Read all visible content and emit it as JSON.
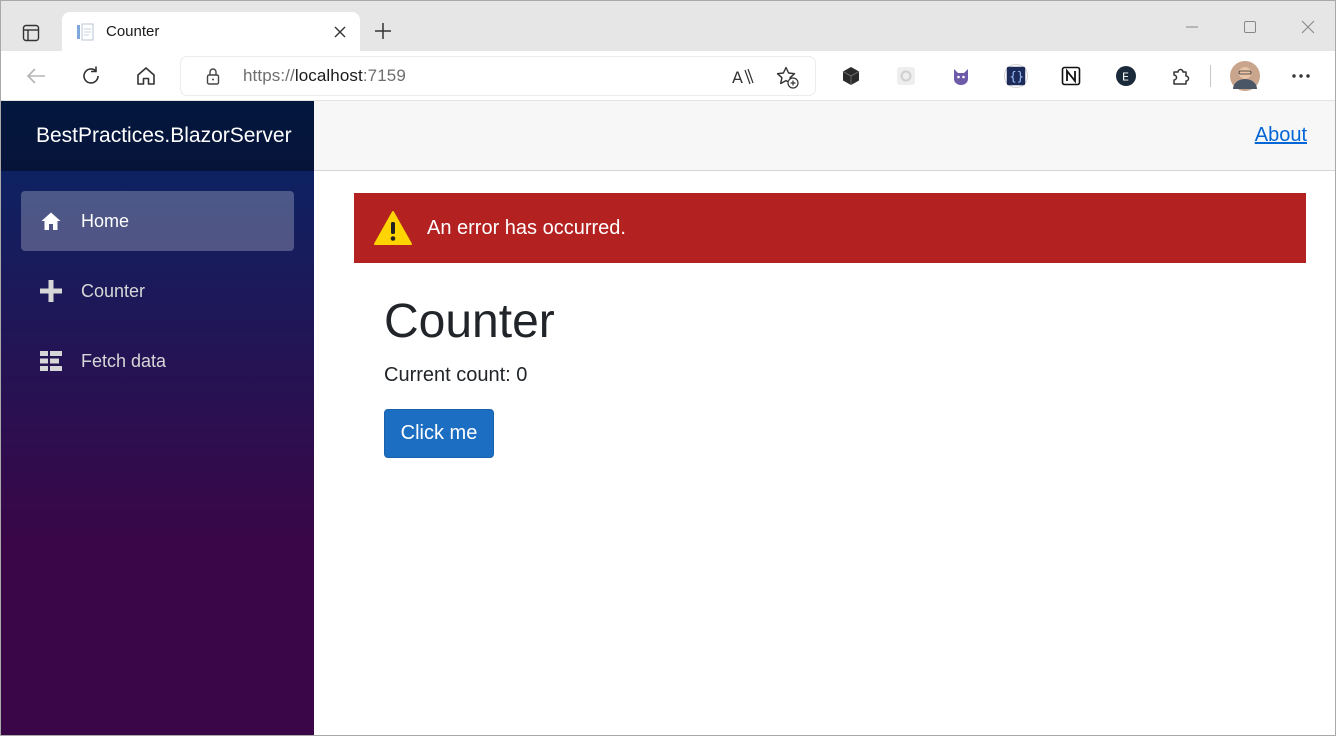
{
  "browser": {
    "tab": {
      "title": "Counter",
      "favicon": "page-icon"
    },
    "address": {
      "scheme": "https://",
      "host": "localhost",
      "port": ":7159"
    },
    "extensions": [
      "cube-icon",
      "gear-icon",
      "cat-icon",
      "json-icon",
      "notion-icon",
      "e-icon",
      "puzzle-icon"
    ],
    "toolbar_icons": [
      "back-icon",
      "refresh-icon",
      "home-icon",
      "read-aloud-icon",
      "favorite-add-icon",
      "more-icon"
    ]
  },
  "app": {
    "brand": "BestPractices.BlazorServer",
    "nav": [
      {
        "label": "Home",
        "icon": "home-icon",
        "active": true
      },
      {
        "label": "Counter",
        "icon": "plus-icon",
        "active": false
      },
      {
        "label": "Fetch data",
        "icon": "list-icon",
        "active": false
      }
    ],
    "topbar": {
      "about": "About"
    },
    "error": {
      "message": "An error has occurred."
    },
    "page": {
      "title": "Counter",
      "count_text": "Current count: 0",
      "button": "Click me"
    },
    "colors": {
      "error": "#b32121",
      "button": "#1b6ec2",
      "link": "#0366d6",
      "sidebar_top": "#052767",
      "sidebar_bottom": "#3a0647"
    }
  }
}
